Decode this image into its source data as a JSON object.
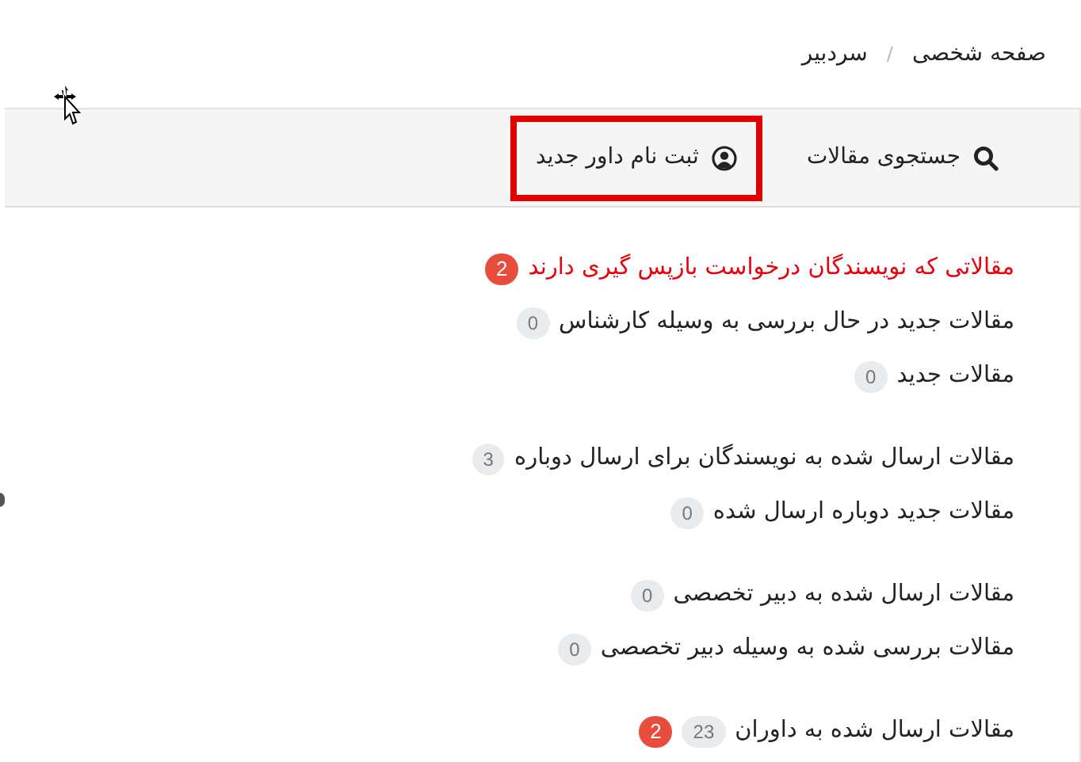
{
  "breadcrumb": [
    {
      "label": "صفحه شخصی"
    },
    {
      "label": "سردبیر"
    }
  ],
  "breadcrumb_separator": "/",
  "toolbar": [
    {
      "kind": "search",
      "label": "جستجوی مقالات",
      "outlined": false
    },
    {
      "kind": "user",
      "label": "ثبت نام داور جدید",
      "outlined": true
    }
  ],
  "groups": [
    {
      "items": [
        {
          "label": "مقالاتی که نویسندگان درخواست بازپس گیری دارند",
          "highlighted": true,
          "alert": "2"
        },
        {
          "label": "مقالات جدید در حال بررسی به وسیله کارشناس",
          "highlighted": false,
          "count": "0"
        },
        {
          "label": "مقالات جدید",
          "highlighted": false,
          "count": "0"
        }
      ]
    },
    {
      "items": [
        {
          "label": "مقالات ارسال شده به نویسندگان برای ارسال دوباره",
          "highlighted": false,
          "count": "3"
        },
        {
          "label": "مقالات جدید دوباره ارسال شده",
          "highlighted": false,
          "count": "0"
        }
      ]
    },
    {
      "items": [
        {
          "label": "مقالات ارسال شده به دبیر تخصصی",
          "highlighted": false,
          "count": "0"
        },
        {
          "label": "مقالات بررسی شده به وسیله دبیر تخصصی",
          "highlighted": false,
          "count": "0"
        }
      ]
    },
    {
      "items": [
        {
          "label": "مقالات ارسال شده به داوران",
          "highlighted": false,
          "count": "23",
          "alert": "2"
        }
      ]
    }
  ]
}
